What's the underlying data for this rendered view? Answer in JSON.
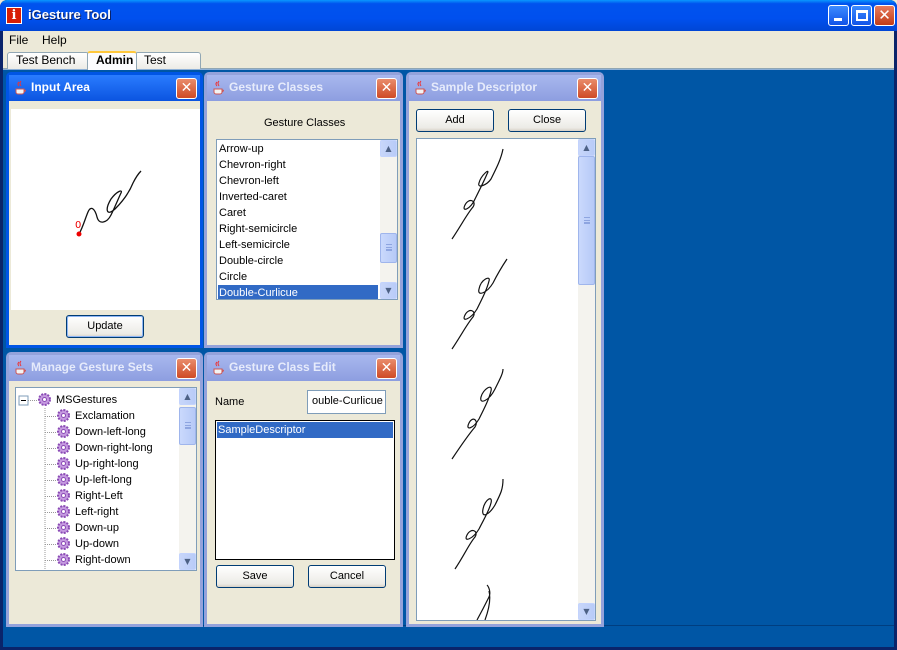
{
  "window": {
    "title": "iGesture Tool",
    "icon_letter": "i"
  },
  "menu": {
    "items": [
      "File",
      "Help"
    ]
  },
  "tabs": [
    {
      "label": "Test Bench",
      "active": false
    },
    {
      "label": "Admin",
      "active": true
    },
    {
      "label": "Test Data",
      "active": false
    }
  ],
  "input_area": {
    "title": "Input Area",
    "start_marker": "0",
    "update_label": "Update"
  },
  "gesture_classes": {
    "title": "Gesture Classes",
    "header": "Gesture Classes",
    "items": [
      "Arrow-up",
      "Chevron-right",
      "Chevron-left",
      "Inverted-caret",
      "Caret",
      "Right-semicircle",
      "Left-semicircle",
      "Double-circle",
      "Circle",
      "Double-Curlicue"
    ],
    "selected": "Double-Curlicue"
  },
  "sample_descriptor": {
    "title": "Sample Descriptor",
    "add_label": "Add",
    "close_label": "Close"
  },
  "gesture_sets": {
    "title": "Manage Gesture Sets",
    "root": "MSGestures",
    "items": [
      "Exclamation",
      "Down-left-long",
      "Down-right-long",
      "Up-right-long",
      "Up-left-long",
      "Right-Left",
      "Left-right",
      "Down-up",
      "Up-down",
      "Right-down"
    ]
  },
  "class_edit": {
    "title": "Gesture Class Edit",
    "name_label": "Name",
    "name_value": "ouble-Curlicue",
    "descriptors": [
      "SampleDescriptor"
    ],
    "save_label": "Save",
    "cancel_label": "Cancel"
  },
  "colors": {
    "desktop": "#0056a5",
    "selection": "#316ac5",
    "xp_title": "#0050ee",
    "close_red": "#cf4a26"
  }
}
